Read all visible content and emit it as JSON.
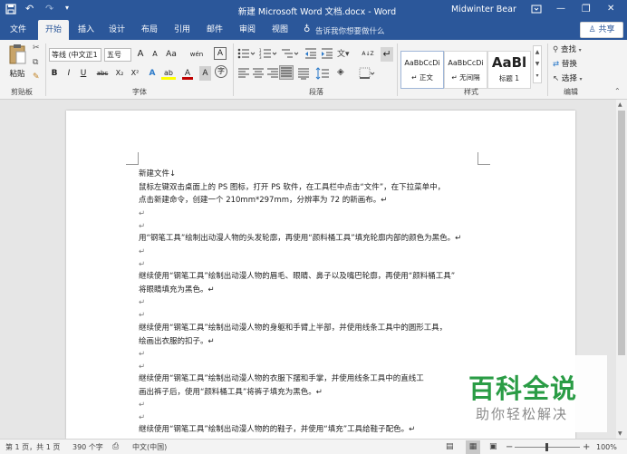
{
  "titlebar": {
    "title": "新建 Microsoft Word 文档.docx - Word",
    "user": "Midwinter Bear",
    "save_icon": "save-icon",
    "undo_icon": "undo-icon",
    "redo_icon": "redo-icon",
    "customize_icon": "customize-icon",
    "ribbon_display_icon": "ribbon-display-icon",
    "minimize_glyph": "—",
    "restore_glyph": "❐",
    "close_glyph": "✕"
  },
  "tabs": [
    "文件",
    "开始",
    "插入",
    "设计",
    "布局",
    "引用",
    "邮件",
    "审阅",
    "视图"
  ],
  "active_tab": "开始",
  "tell_me": "告诉我你想要做什么",
  "share": "共享",
  "ribbon": {
    "clipboard": {
      "paste": "粘贴",
      "group": "剪贴板"
    },
    "font": {
      "font_name": "等线 (中文正1",
      "font_size": "五号",
      "grow": "A",
      "shrink": "A",
      "clear": "Aa",
      "phonetic": "wén",
      "charborder": "A",
      "bold": "B",
      "italic": "I",
      "underline": "U",
      "strike": "abc",
      "sub": "X₂",
      "sup": "X²",
      "effects": "A",
      "highlight": "ab",
      "color": "A",
      "shade": "A",
      "enclose": "字",
      "group": "字体"
    },
    "paragraph": {
      "group": "段落",
      "sort": "A↓Z",
      "marks": "↵"
    },
    "styles": {
      "items": [
        {
          "preview": "AaBbCcDi",
          "name": "↵ 正文"
        },
        {
          "preview": "AaBbCcDi",
          "name": "↵ 无间隔"
        },
        {
          "preview": "AaBl",
          "name": "标题 1"
        }
      ],
      "group": "样式"
    },
    "editing": {
      "find": "查找",
      "replace": "替换",
      "select": "选择",
      "group": "编辑"
    }
  },
  "document": {
    "lines": [
      "新建文件↓",
      "鼠标左键双击桌面上的 PS 图标，打开 PS 软件，在工具栏中点击“文件”，在下拉菜单中，",
      "点击新建命令，创建一个 210mm*297mm，分辨率为 72 的新画布。↵",
      "↵",
      "↵",
      "用“钢笔工具”绘制出动漫人物的头发轮廓，再使用“颜料桶工具”填充轮廓内部的颜色为黑色。↵",
      "↵",
      "↵",
      "继续使用“钢笔工具”绘制出动漫人物的眉毛、眼睛、鼻子以及嘴巴轮廓，再使用“颜料桶工具”",
      "将眼睛填充为黑色。↵",
      "↵",
      "↵",
      "继续使用“钢笔工具”绘制出动漫人物的身躯和手臂上半部，并使用线条工具中的圆形工具，",
      "绘画出衣服的扣子。↵",
      "↵",
      "↵",
      "继续使用“钢笔工具”绘制出动漫人物的衣服下摆和手掌，并使用线条工具中的直线工",
      "画出裤子后，使用“颜料桶工具”将裤子填充为黑色。↵",
      "↵",
      "↵",
      "继续使用“钢笔工具”绘制出动漫人物的的鞋子，并使用“填充”工具给鞋子配色。↵"
    ]
  },
  "watermark": {
    "title": "百科全说",
    "subtitle": "助你轻松解决"
  },
  "statusbar": {
    "page": "第 1 页，共 1 页",
    "words": "390 个字",
    "language": "中文(中国)",
    "zoom": "100%",
    "zoom_out": "−",
    "zoom_in": "+",
    "zoom_level": 1.0
  },
  "colors": {
    "accent": "#2b579a",
    "highlight": "#ffff00",
    "font_color": "#c00000",
    "watermark_green": "#2a9c45",
    "watermark_gray": "#8a8a8a"
  }
}
